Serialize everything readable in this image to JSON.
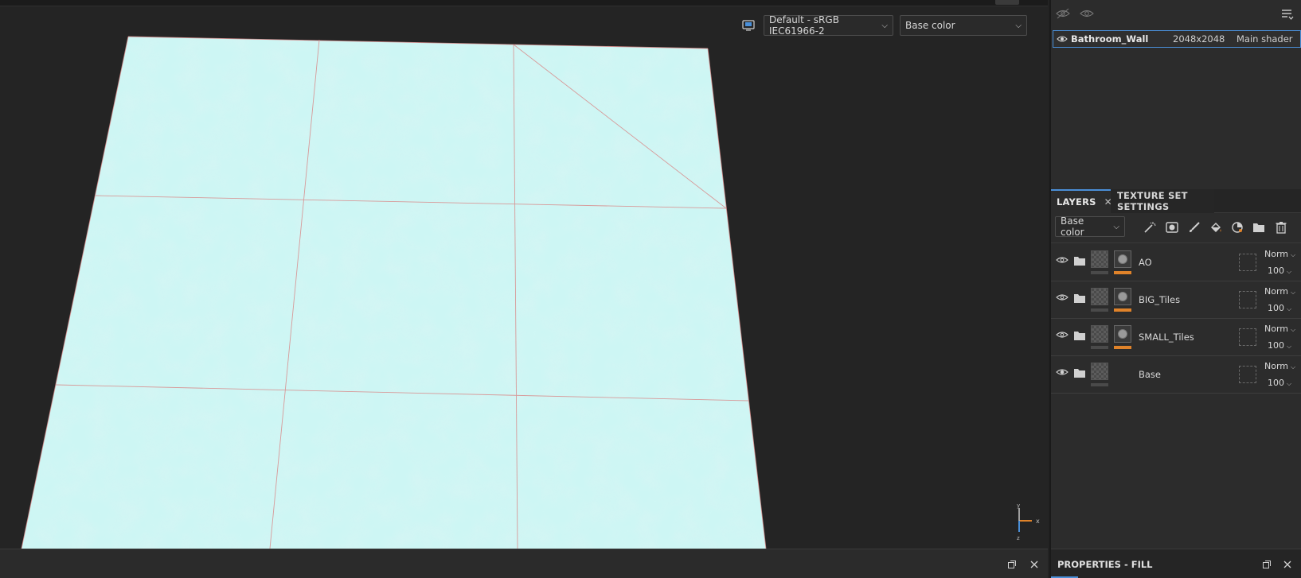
{
  "viewport": {
    "colorspace_value": "Default - sRGB IEC61966-2",
    "channel_value": "Base color",
    "axis_x_label": "x",
    "axis_y_label": "y",
    "axis_z_label": "z",
    "surface_color": "#cdf6f4",
    "seam_color": "#d98a8a"
  },
  "texture_set": {
    "name": "Bathroom_Wall",
    "resolution": "2048x2048",
    "shader": "Main shader"
  },
  "tabs": {
    "layers_label": "LAYERS",
    "texture_set_settings_label": "TEXTURE SET SETTINGS"
  },
  "layers_toolbar": {
    "channel_value": "Base color",
    "tools": [
      "magic-wand-icon",
      "mask-icon",
      "brush-icon",
      "fill-bucket-icon",
      "smart-material-icon",
      "folder-icon",
      "trash-icon"
    ]
  },
  "layers": [
    {
      "name": "AO",
      "blend": "Norm",
      "opacity": "100",
      "has_mask": true
    },
    {
      "name": "BIG_Tiles",
      "blend": "Norm",
      "opacity": "100",
      "has_mask": true
    },
    {
      "name": "SMALL_Tiles",
      "blend": "Norm",
      "opacity": "100",
      "has_mask": true
    },
    {
      "name": "Base",
      "blend": "Norm",
      "opacity": "100",
      "has_mask": false
    }
  ],
  "properties": {
    "title": "PROPERTIES - FILL"
  },
  "colors": {
    "accent": "#4a8fd8",
    "mask_bar": "#e0832a"
  }
}
